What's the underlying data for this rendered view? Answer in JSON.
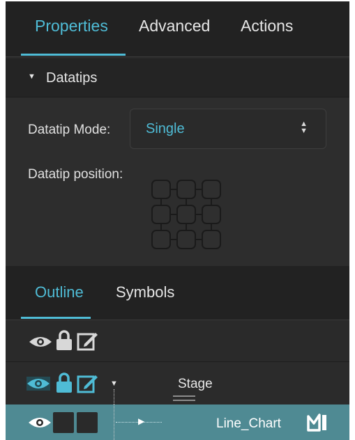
{
  "tabs": [
    {
      "label": "Properties",
      "active": true
    },
    {
      "label": "Advanced",
      "active": false
    },
    {
      "label": "Actions",
      "active": false
    }
  ],
  "section": {
    "title": "Datatips",
    "datatip_mode_label": "Datatip Mode:",
    "datatip_mode_value": "Single",
    "datatip_position_label": "Datatip position:"
  },
  "outline_tabs": [
    {
      "label": "Outline",
      "active": true
    },
    {
      "label": "Symbols",
      "active": false
    }
  ],
  "outline": {
    "toolbar_icons": [
      "eye-icon",
      "lock-icon",
      "edit-icon"
    ],
    "rows": [
      {
        "label": "Stage",
        "icons": [
          "eye-icon",
          "lock-icon",
          "edit-icon",
          "triangle-down-icon"
        ]
      },
      {
        "label": "Line_Chart",
        "selected": true,
        "icons": [
          "eye-icon",
          "chart-icon"
        ]
      }
    ]
  },
  "colors": {
    "accent": "#4fbcd6",
    "panel_bg": "#2b2b2b",
    "selected_row": "#4f8a93"
  }
}
